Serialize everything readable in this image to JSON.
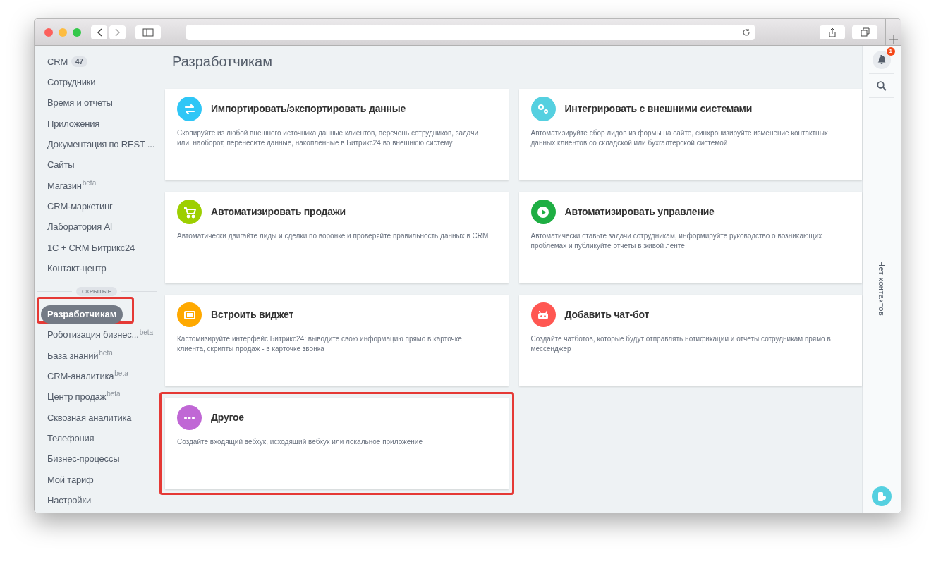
{
  "page": {
    "title": "Разработчикам"
  },
  "sidebar": {
    "items": [
      {
        "label": "CRM",
        "badge": "47",
        "selected": false
      },
      {
        "label": "Сотрудники",
        "selected": false
      },
      {
        "label": "Время и отчеты",
        "selected": false
      },
      {
        "label": "Приложения",
        "selected": false
      },
      {
        "label": "Документация по REST ...",
        "selected": false
      },
      {
        "label": "Сайты",
        "selected": false
      },
      {
        "label": "Магазин",
        "beta": "beta",
        "selected": false
      },
      {
        "label": "CRM-маркетинг",
        "selected": false
      },
      {
        "label": "Лаборатория AI",
        "selected": false
      },
      {
        "label": "1С + CRM Битрикс24",
        "selected": false
      },
      {
        "label": "Контакт-центр",
        "selected": false
      }
    ],
    "hidden_label": "СКРЫТЫЕ",
    "hidden_items": [
      {
        "label": "Разработчикам",
        "selected": true,
        "highlighted": true
      },
      {
        "label": "Роботизация бизнес...",
        "beta": "beta",
        "selected": false,
        "highlighted": false
      },
      {
        "label": "База знаний",
        "beta": "beta",
        "selected": false,
        "highlighted": false
      },
      {
        "label": "CRM-аналитика",
        "beta": "beta",
        "selected": false,
        "highlighted": false
      },
      {
        "label": "Центр продаж",
        "beta": "beta",
        "selected": false,
        "highlighted": false
      },
      {
        "label": "Сквозная аналитика",
        "selected": false,
        "highlighted": false
      },
      {
        "label": "Телефония",
        "selected": false,
        "highlighted": false
      },
      {
        "label": "Бизнес-процессы",
        "selected": false,
        "highlighted": false
      },
      {
        "label": "Мой тариф",
        "selected": false,
        "highlighted": false
      },
      {
        "label": "Настройки",
        "selected": false,
        "highlighted": false
      }
    ]
  },
  "cards": [
    {
      "kind": "exchange",
      "color": "#2fc6f6",
      "title": "Импортировать/экспортировать данные",
      "description": "Скопируйте из любой внешнего источника данные клиентов, перечень сотрудников, задачи или, наоборот, перенесите данные, накопленные в Битрикс24 во внешнюю систему",
      "highlighted": false
    },
    {
      "kind": "gears",
      "color": "#55d0e0",
      "title": "Интегрировать с внешними системами",
      "description": "Автоматизируйте сбор лидов из формы на сайте, синхронизируйте изменение контактных данных клиентов со складской или бухгалтерской системой",
      "highlighted": false
    },
    {
      "kind": "cart",
      "color": "#9dcf00",
      "title": "Автоматизировать продажи",
      "description": "Автоматически двигайте лиды и сделки по воронке и проверяйте правильность данных в CRM",
      "highlighted": false
    },
    {
      "kind": "play",
      "color": "#1eae43",
      "title": "Автоматизировать управление",
      "description": "Автоматически ставьте задачи сотрудникам, информируйте руководство о возникающих проблемах и публикуйте отчеты в живой ленте",
      "highlighted": false
    },
    {
      "kind": "widget",
      "color": "#ffa900",
      "title": "Встроить виджет",
      "description": "Кастомизируйте интерфейс Битрикс24: выводите свою информацию прямо в карточке клиента, скрипты продаж - в карточке звонка",
      "highlighted": false
    },
    {
      "kind": "robot",
      "color": "#ff5752",
      "title": "Добавить чат-бот",
      "description": "Создайте чатботов, которые будут отправлять нотификации и отчеты сотрудникам прямо в мессенджер",
      "highlighted": false
    },
    {
      "kind": "dots",
      "color": "#c067d5",
      "title": "Другое",
      "description": "Создайте входящий вебхук, исходящий вебхук или локальное приложение",
      "highlighted": true
    }
  ],
  "right_panel": {
    "notification_count": "1",
    "empty_text": "Нет контактов"
  }
}
